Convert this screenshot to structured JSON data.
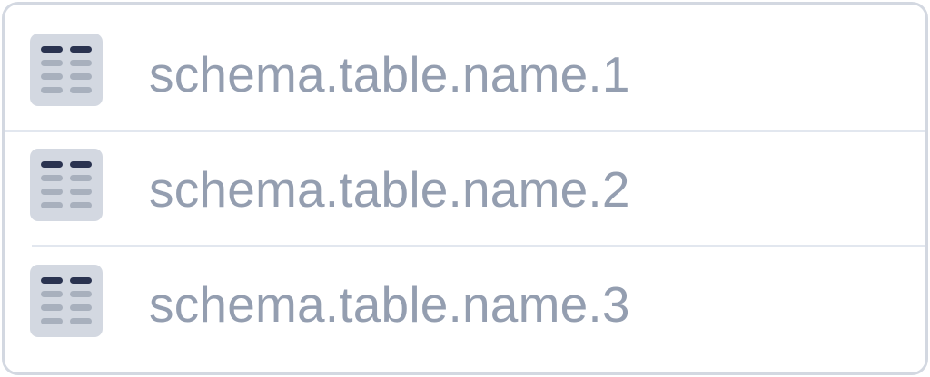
{
  "table_list": {
    "items": [
      {
        "name": "schema.table.name.1",
        "icon": "table-icon"
      },
      {
        "name": "schema.table.name.2",
        "icon": "table-icon"
      },
      {
        "name": "schema.table.name.3",
        "icon": "table-icon"
      }
    ]
  },
  "colors": {
    "border": "#d3d8e1",
    "divider": "#e2e7ef",
    "icon_bg": "#d3d8e1",
    "icon_header": "#2a3350",
    "icon_cells": "#a8b0bd",
    "label_text": "#949eb0"
  }
}
